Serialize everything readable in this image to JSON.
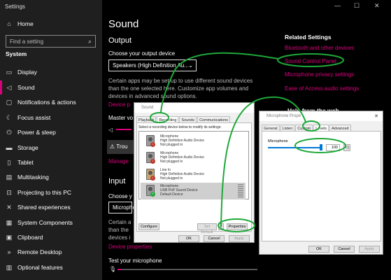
{
  "window": {
    "title": "Settings",
    "minimize": "—",
    "maximize": "☐",
    "close": "✕"
  },
  "sidebar": {
    "home": "Home",
    "search_placeholder": "Find a setting",
    "section": "System",
    "items": [
      {
        "label": "Display",
        "icon": "display-icon"
      },
      {
        "label": "Sound",
        "icon": "speaker-icon"
      },
      {
        "label": "Notifications & actions",
        "icon": "notifications-icon"
      },
      {
        "label": "Focus assist",
        "icon": "moon-icon"
      },
      {
        "label": "Power & sleep",
        "icon": "power-icon"
      },
      {
        "label": "Storage",
        "icon": "storage-icon"
      },
      {
        "label": "Tablet",
        "icon": "tablet-icon"
      },
      {
        "label": "Multitasking",
        "icon": "multitasking-icon"
      },
      {
        "label": "Projecting to this PC",
        "icon": "projecting-icon"
      },
      {
        "label": "Shared experiences",
        "icon": "shared-icon"
      },
      {
        "label": "System Components",
        "icon": "components-icon"
      },
      {
        "label": "Clipboard",
        "icon": "clipboard-icon"
      },
      {
        "label": "Remote Desktop",
        "icon": "remote-desktop-icon"
      },
      {
        "label": "Optional features",
        "icon": "optional-features-icon"
      }
    ]
  },
  "main": {
    "title": "Sound",
    "output_heading": "Output",
    "output_device_label": "Choose your output device",
    "output_device_value": "Speakers (High Definition Au...",
    "output_desc_1": "Certain apps may be set up to use different sound devices",
    "output_desc_2": "than the one selected here. Customize app volumes and",
    "output_desc_3": "devices in advanced sound options.",
    "device_properties_link_partial": "Device p",
    "master_volume_partial": "Master vo",
    "troubleshoot_partial": "Trou",
    "manage_partial": "Manage",
    "input_heading": "Input",
    "input_device_label_partial": "Choose y",
    "input_device_value_partial": "Microphor",
    "input_desc_1_partial": "Certain a",
    "input_desc_2_partial": "than the",
    "input_desc_3_partial": "devices i",
    "input_device_properties": "Device properties",
    "test_mic_label": "Test your microphone"
  },
  "related": {
    "heading": "Related Settings",
    "links": [
      "Bluetooth and other devices",
      "Sound Control Panel",
      "Microphone privacy settings",
      "Ease of Access audio settings"
    ],
    "help_heading_partial": "Help from the web"
  },
  "sound_dialog": {
    "title": "Sound",
    "tabs": [
      "Playback",
      "Recording",
      "Sounds",
      "Communications"
    ],
    "selected_tab": "Recording",
    "instruction": "Select a recording device below to modify its settings:",
    "devices": [
      {
        "name": "Microphone",
        "driver": "High Definition Audio Device",
        "status": "Not plugged in"
      },
      {
        "name": "Microphone",
        "driver": "High Definition Audio Device",
        "status": "Not plugged in"
      },
      {
        "name": "Line In",
        "driver": "High Definition Audio Device",
        "status": "Not plugged in"
      },
      {
        "name": "Microphone",
        "driver": "USB PnP Sound Device",
        "status": "Default Device"
      }
    ],
    "configure": "Configure",
    "set_default": "Set Default",
    "properties": "Properties",
    "ok": "OK",
    "cancel": "Cancel",
    "apply": "Apply"
  },
  "mic_dialog": {
    "title_partial": "Microphone Prope",
    "tabs": [
      "General",
      "Listen",
      "Custom",
      "Levels",
      "Advanced"
    ],
    "selected_tab": "Levels",
    "section": "Microphone",
    "level_value": "100",
    "level": 1.0,
    "ok": "OK",
    "cancel": "Cancel",
    "apply": "Apply"
  },
  "colors": {
    "accent": "#d9007c",
    "annotation": "#1fa83a",
    "background": "#000000",
    "sidebar": "#1f1f1f"
  }
}
